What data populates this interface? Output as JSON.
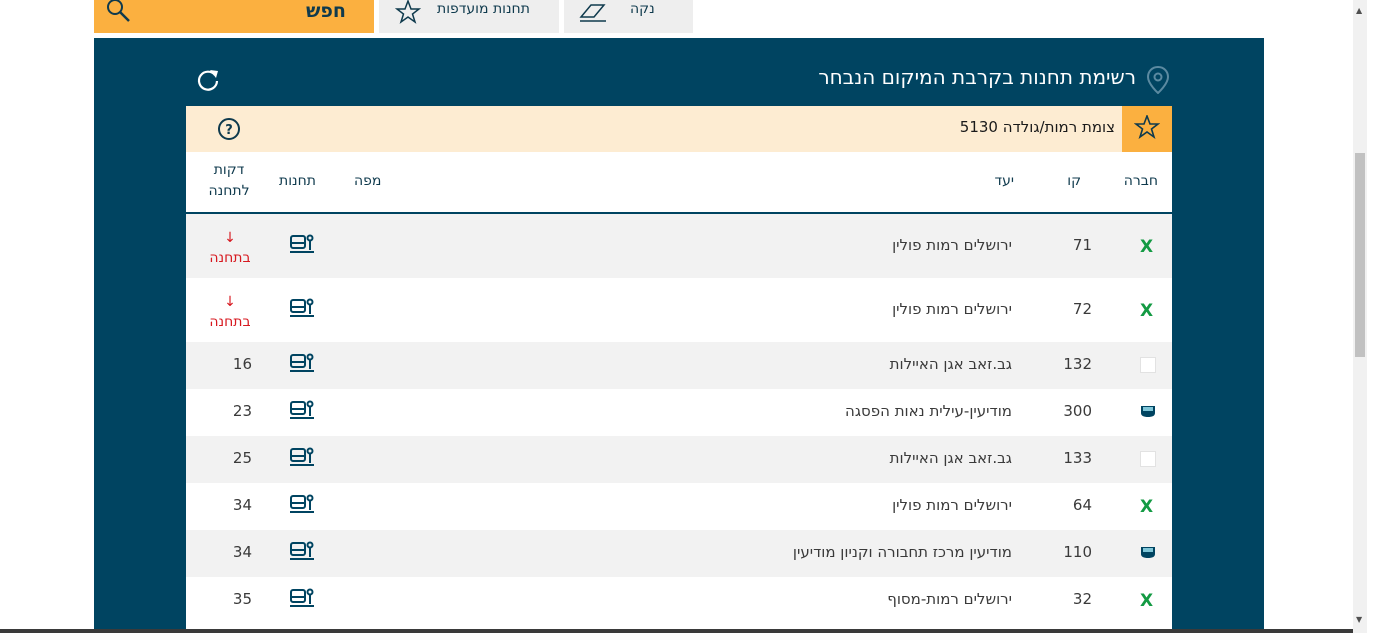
{
  "toolbar": {
    "search_label": "חפש",
    "favorites_label": "תחנות מועדפות",
    "clear_label": "נקה"
  },
  "panel": {
    "title": "רשימת תחנות בקרבת המיקום הנבחר"
  },
  "station": {
    "name": "צומת רמות/גולדה 5130"
  },
  "table": {
    "headers": {
      "company": "חברה",
      "line": "קו",
      "destination": "יעד",
      "map": "מפה",
      "stations": "תחנות",
      "minutes": "דקות לתחנה"
    },
    "rows": [
      {
        "company_icon": "afikim-logo",
        "line": "71",
        "destination": "ירושלים רמות פולין",
        "arrival": "בתחנה",
        "minutes": ""
      },
      {
        "company_icon": "afikim-logo",
        "line": "72",
        "destination": "ירושלים רמות פולין",
        "arrival": "בתחנה",
        "minutes": ""
      },
      {
        "company_icon": "blank-logo",
        "line": "132",
        "destination": "גב.זאב אגן האיילות",
        "arrival": "",
        "minutes": "16"
      },
      {
        "company_icon": "superbus-logo",
        "line": "300",
        "destination": "מודיעין-עילית נאות הפסגה",
        "arrival": "",
        "minutes": "23"
      },
      {
        "company_icon": "blank-logo",
        "line": "133",
        "destination": "גב.זאב אגן האיילות",
        "arrival": "",
        "minutes": "25"
      },
      {
        "company_icon": "afikim-logo",
        "line": "64",
        "destination": "ירושלים רמות פולין",
        "arrival": "",
        "minutes": "34"
      },
      {
        "company_icon": "superbus-logo",
        "line": "110",
        "destination": "מודיעין מרכז תחבורה וקניון מודיעין",
        "arrival": "",
        "minutes": "34"
      },
      {
        "company_icon": "afikim-logo",
        "line": "32",
        "destination": "ירושלים רמות-מסוף",
        "arrival": "",
        "minutes": "35"
      }
    ]
  },
  "colors": {
    "panel": "#004461",
    "accent": "#fbb040",
    "station_bar": "#fdecd2",
    "arrival_red": "#d71920"
  }
}
